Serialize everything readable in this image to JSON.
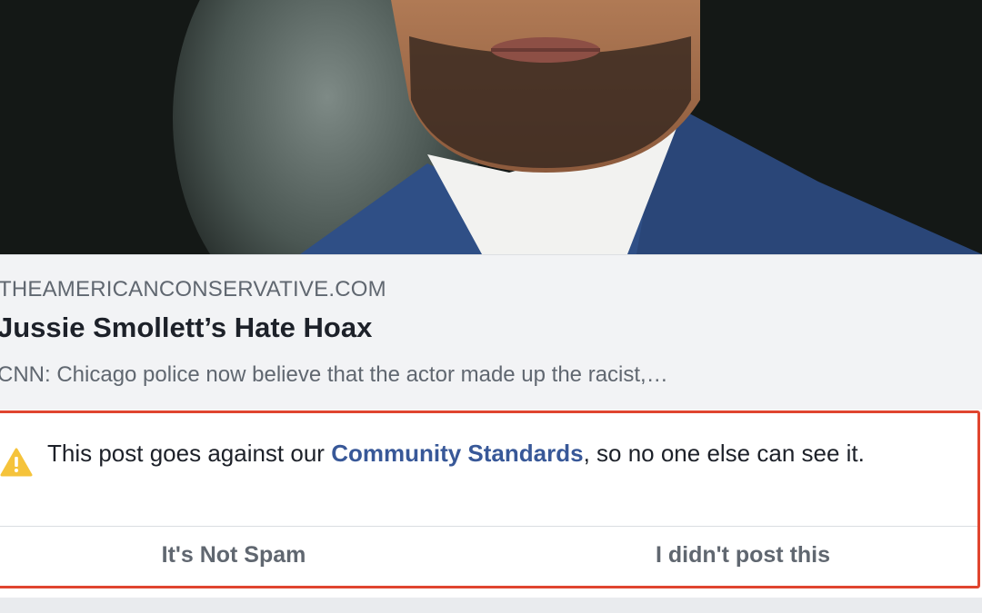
{
  "link_preview": {
    "image_name": "portrait-photo",
    "domain": "THEAMERICANCONSERVATIVE.COM",
    "headline": "Jussie Smollett’s Hate Hoax",
    "description": "CNN: Chicago police now believe that the actor made up the racist,…"
  },
  "notice": {
    "icon": "warning-triangle-icon",
    "text_before": "This post goes against our ",
    "link_label": "Community Standards",
    "text_after": ", so no one else can see it."
  },
  "actions": {
    "not_spam_label": "It's Not Spam",
    "didnt_post_label": "I didn't post this"
  },
  "colors": {
    "highlight_outline": "#e0452f",
    "link": "#385898",
    "warning": "#f5c33b"
  }
}
